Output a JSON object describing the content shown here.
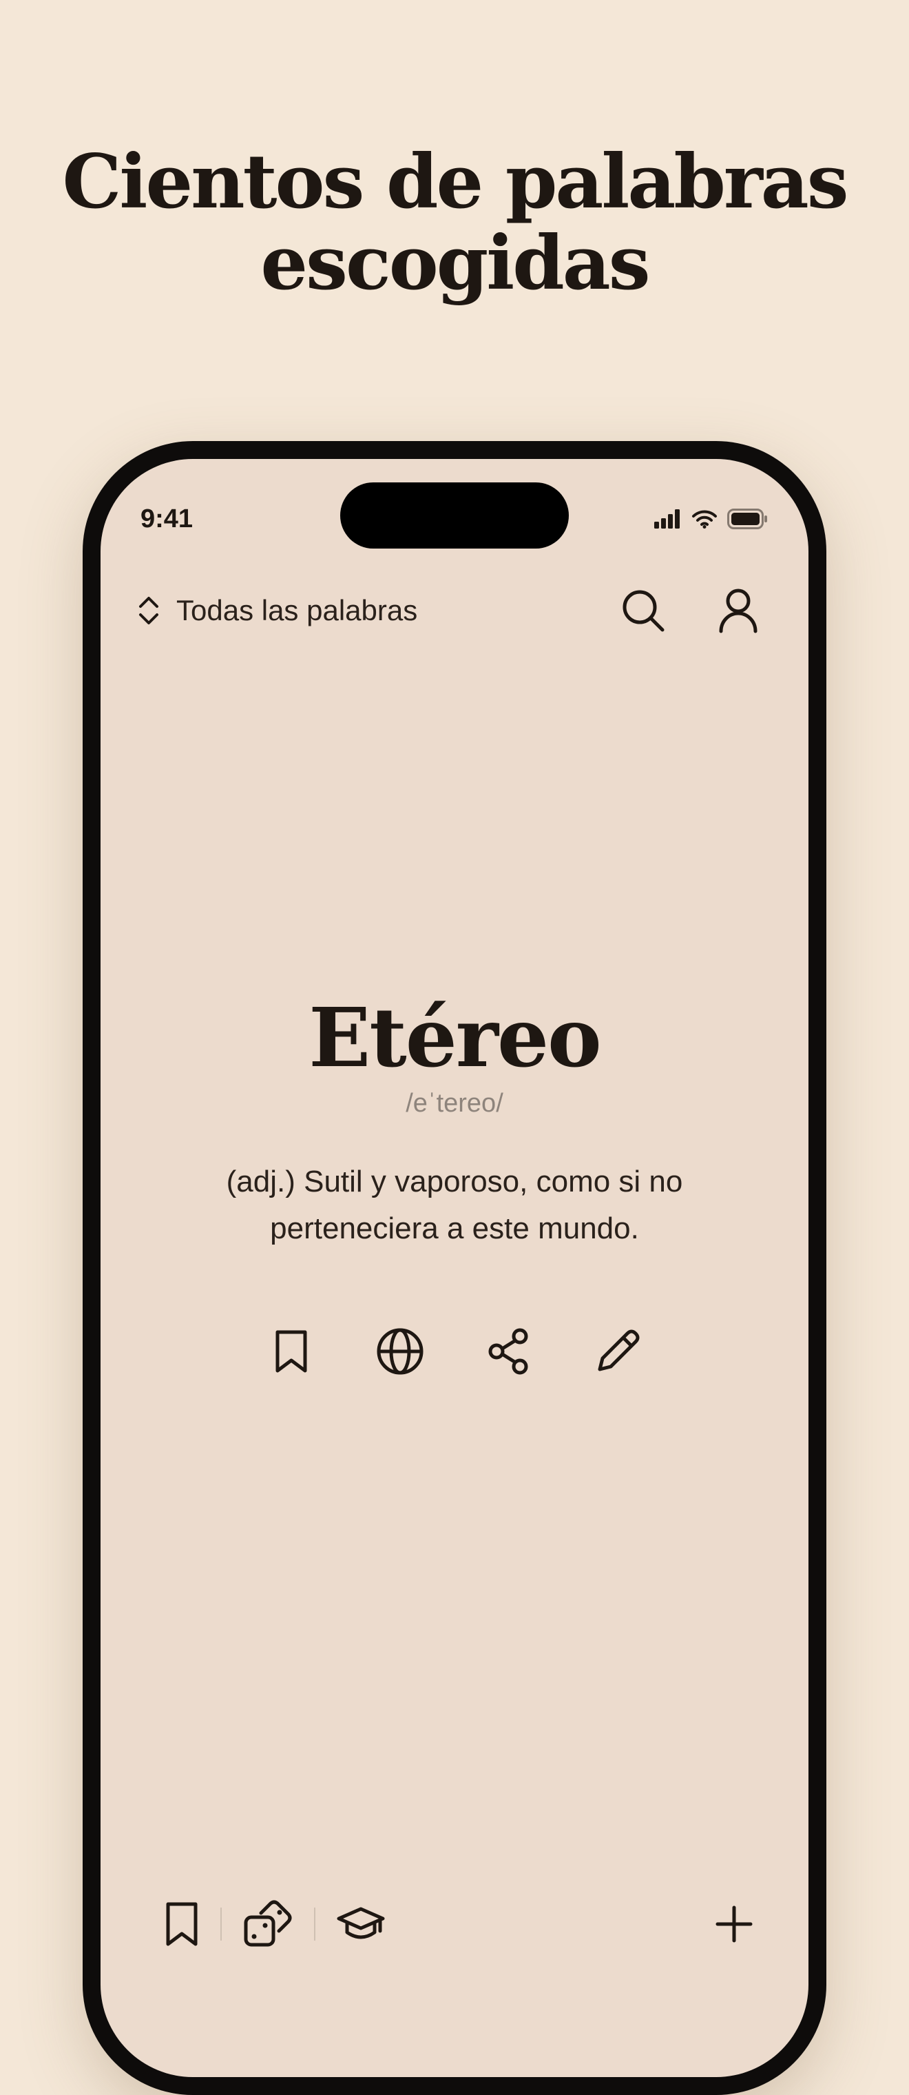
{
  "headline": {
    "line1": "Cientos de palabras",
    "line2": "escogidas"
  },
  "status_bar": {
    "time": "9:41",
    "icons": [
      "cellular-signal-icon",
      "wifi-icon",
      "battery-icon"
    ]
  },
  "top_bar": {
    "filter_label": "Todas las palabras",
    "filter_icon": "chevron-up-down-icon",
    "search_icon": "search-icon",
    "profile_icon": "user-icon"
  },
  "word_card": {
    "word": "Etéreo",
    "phonetic": "/eˈtereo/",
    "definition": "(adj.) Sutil y vaporoso, como si no perteneciera a este mundo."
  },
  "actions": [
    {
      "icon": "bookmark-icon"
    },
    {
      "icon": "globe-icon"
    },
    {
      "icon": "share-icon"
    },
    {
      "icon": "pencil-icon"
    }
  ],
  "bottom_bar": {
    "items": [
      "bookmark-icon",
      "dice-icon",
      "graduation-cap-icon"
    ],
    "add_icon": "plus-icon"
  },
  "colors": {
    "background": "#F4E7D7",
    "screen": "#ECDBCD",
    "text": "#1E1712",
    "muted": "#8E847C",
    "frame": "#0E0C0B"
  }
}
